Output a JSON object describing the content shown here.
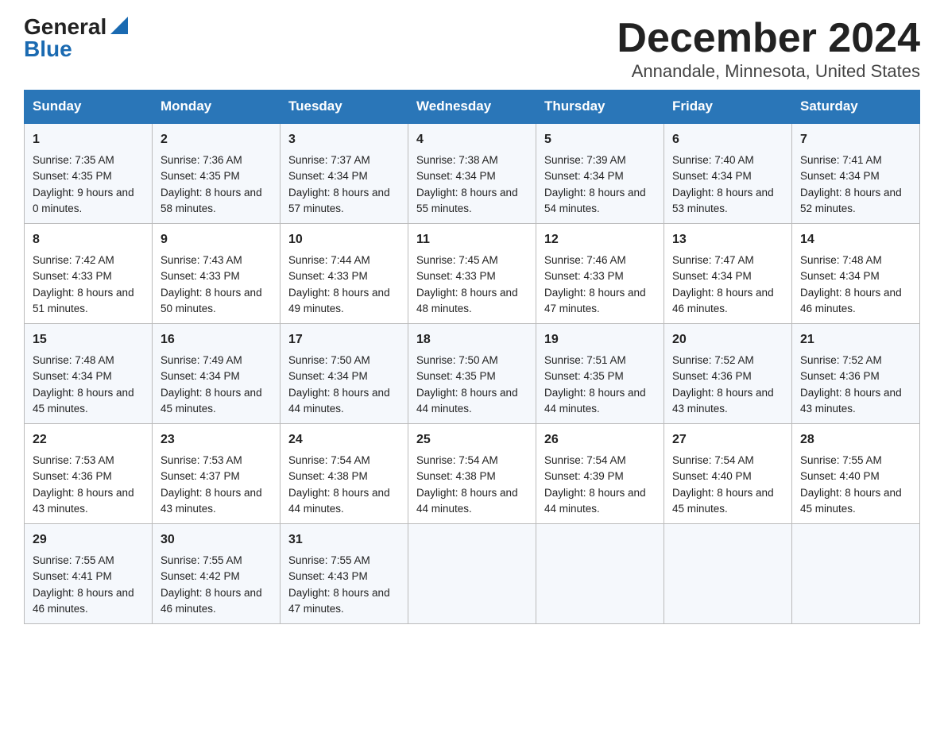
{
  "header": {
    "logo_general": "General",
    "logo_blue": "Blue",
    "title": "December 2024",
    "subtitle": "Annandale, Minnesota, United States"
  },
  "weekdays": [
    "Sunday",
    "Monday",
    "Tuesday",
    "Wednesday",
    "Thursday",
    "Friday",
    "Saturday"
  ],
  "weeks": [
    [
      {
        "day": "1",
        "sunrise": "7:35 AM",
        "sunset": "4:35 PM",
        "daylight": "9 hours and 0 minutes."
      },
      {
        "day": "2",
        "sunrise": "7:36 AM",
        "sunset": "4:35 PM",
        "daylight": "8 hours and 58 minutes."
      },
      {
        "day": "3",
        "sunrise": "7:37 AM",
        "sunset": "4:34 PM",
        "daylight": "8 hours and 57 minutes."
      },
      {
        "day": "4",
        "sunrise": "7:38 AM",
        "sunset": "4:34 PM",
        "daylight": "8 hours and 55 minutes."
      },
      {
        "day": "5",
        "sunrise": "7:39 AM",
        "sunset": "4:34 PM",
        "daylight": "8 hours and 54 minutes."
      },
      {
        "day": "6",
        "sunrise": "7:40 AM",
        "sunset": "4:34 PM",
        "daylight": "8 hours and 53 minutes."
      },
      {
        "day": "7",
        "sunrise": "7:41 AM",
        "sunset": "4:34 PM",
        "daylight": "8 hours and 52 minutes."
      }
    ],
    [
      {
        "day": "8",
        "sunrise": "7:42 AM",
        "sunset": "4:33 PM",
        "daylight": "8 hours and 51 minutes."
      },
      {
        "day": "9",
        "sunrise": "7:43 AM",
        "sunset": "4:33 PM",
        "daylight": "8 hours and 50 minutes."
      },
      {
        "day": "10",
        "sunrise": "7:44 AM",
        "sunset": "4:33 PM",
        "daylight": "8 hours and 49 minutes."
      },
      {
        "day": "11",
        "sunrise": "7:45 AM",
        "sunset": "4:33 PM",
        "daylight": "8 hours and 48 minutes."
      },
      {
        "day": "12",
        "sunrise": "7:46 AM",
        "sunset": "4:33 PM",
        "daylight": "8 hours and 47 minutes."
      },
      {
        "day": "13",
        "sunrise": "7:47 AM",
        "sunset": "4:34 PM",
        "daylight": "8 hours and 46 minutes."
      },
      {
        "day": "14",
        "sunrise": "7:48 AM",
        "sunset": "4:34 PM",
        "daylight": "8 hours and 46 minutes."
      }
    ],
    [
      {
        "day": "15",
        "sunrise": "7:48 AM",
        "sunset": "4:34 PM",
        "daylight": "8 hours and 45 minutes."
      },
      {
        "day": "16",
        "sunrise": "7:49 AM",
        "sunset": "4:34 PM",
        "daylight": "8 hours and 45 minutes."
      },
      {
        "day": "17",
        "sunrise": "7:50 AM",
        "sunset": "4:34 PM",
        "daylight": "8 hours and 44 minutes."
      },
      {
        "day": "18",
        "sunrise": "7:50 AM",
        "sunset": "4:35 PM",
        "daylight": "8 hours and 44 minutes."
      },
      {
        "day": "19",
        "sunrise": "7:51 AM",
        "sunset": "4:35 PM",
        "daylight": "8 hours and 44 minutes."
      },
      {
        "day": "20",
        "sunrise": "7:52 AM",
        "sunset": "4:36 PM",
        "daylight": "8 hours and 43 minutes."
      },
      {
        "day": "21",
        "sunrise": "7:52 AM",
        "sunset": "4:36 PM",
        "daylight": "8 hours and 43 minutes."
      }
    ],
    [
      {
        "day": "22",
        "sunrise": "7:53 AM",
        "sunset": "4:36 PM",
        "daylight": "8 hours and 43 minutes."
      },
      {
        "day": "23",
        "sunrise": "7:53 AM",
        "sunset": "4:37 PM",
        "daylight": "8 hours and 43 minutes."
      },
      {
        "day": "24",
        "sunrise": "7:54 AM",
        "sunset": "4:38 PM",
        "daylight": "8 hours and 44 minutes."
      },
      {
        "day": "25",
        "sunrise": "7:54 AM",
        "sunset": "4:38 PM",
        "daylight": "8 hours and 44 minutes."
      },
      {
        "day": "26",
        "sunrise": "7:54 AM",
        "sunset": "4:39 PM",
        "daylight": "8 hours and 44 minutes."
      },
      {
        "day": "27",
        "sunrise": "7:54 AM",
        "sunset": "4:40 PM",
        "daylight": "8 hours and 45 minutes."
      },
      {
        "day": "28",
        "sunrise": "7:55 AM",
        "sunset": "4:40 PM",
        "daylight": "8 hours and 45 minutes."
      }
    ],
    [
      {
        "day": "29",
        "sunrise": "7:55 AM",
        "sunset": "4:41 PM",
        "daylight": "8 hours and 46 minutes."
      },
      {
        "day": "30",
        "sunrise": "7:55 AM",
        "sunset": "4:42 PM",
        "daylight": "8 hours and 46 minutes."
      },
      {
        "day": "31",
        "sunrise": "7:55 AM",
        "sunset": "4:43 PM",
        "daylight": "8 hours and 47 minutes."
      },
      null,
      null,
      null,
      null
    ]
  ],
  "labels": {
    "sunrise": "Sunrise:",
    "sunset": "Sunset:",
    "daylight": "Daylight:"
  }
}
